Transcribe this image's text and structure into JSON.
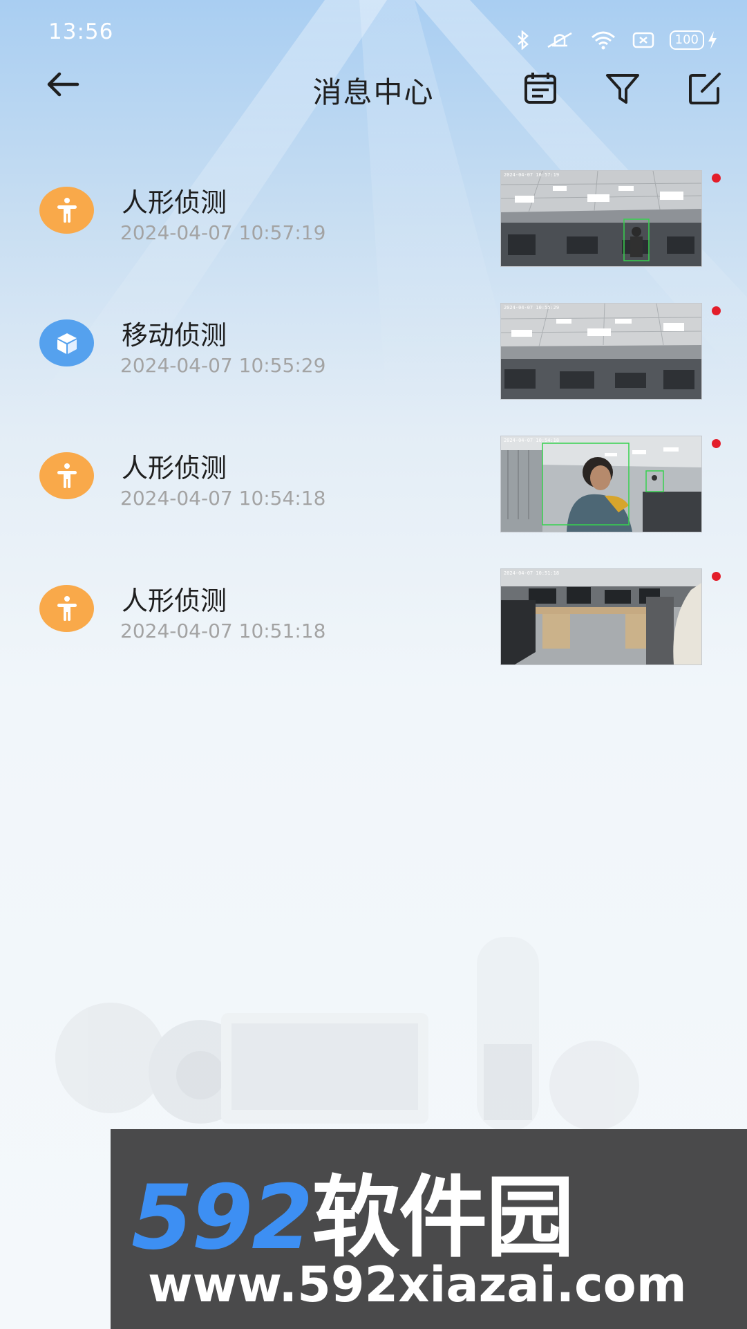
{
  "status_bar": {
    "time": "13:56",
    "battery": "100"
  },
  "header": {
    "title": "消息中心",
    "icons": [
      "back-arrow-icon",
      "calendar-icon",
      "filter-icon",
      "edit-icon"
    ]
  },
  "messages": [
    {
      "type": "人形侦测",
      "time": "2024-04-07 10:57:19",
      "icon": "person-icon",
      "icon_color": "#f9a94a",
      "unread": true,
      "thumb_stamp": "2024-04-07 10:57:19"
    },
    {
      "type": "移动侦测",
      "time": "2024-04-07 10:55:29",
      "icon": "cube-icon",
      "icon_color": "#55a1ee",
      "unread": true,
      "thumb_stamp": "2024-04-07 10:55:29"
    },
    {
      "type": "人形侦测",
      "time": "2024-04-07 10:54:18",
      "icon": "person-icon",
      "icon_color": "#f9a94a",
      "unread": true,
      "thumb_stamp": "2024-04-07 10:54:18"
    },
    {
      "type": "人形侦测",
      "time": "2024-04-07 10:51:18",
      "icon": "person-icon",
      "icon_color": "#f9a94a",
      "unread": true,
      "thumb_stamp": "2024-04-07 10:51:18"
    }
  ],
  "watermark": {
    "brand_num": "592",
    "brand_cn": "软件园",
    "url": "www.592xiazai.com"
  }
}
